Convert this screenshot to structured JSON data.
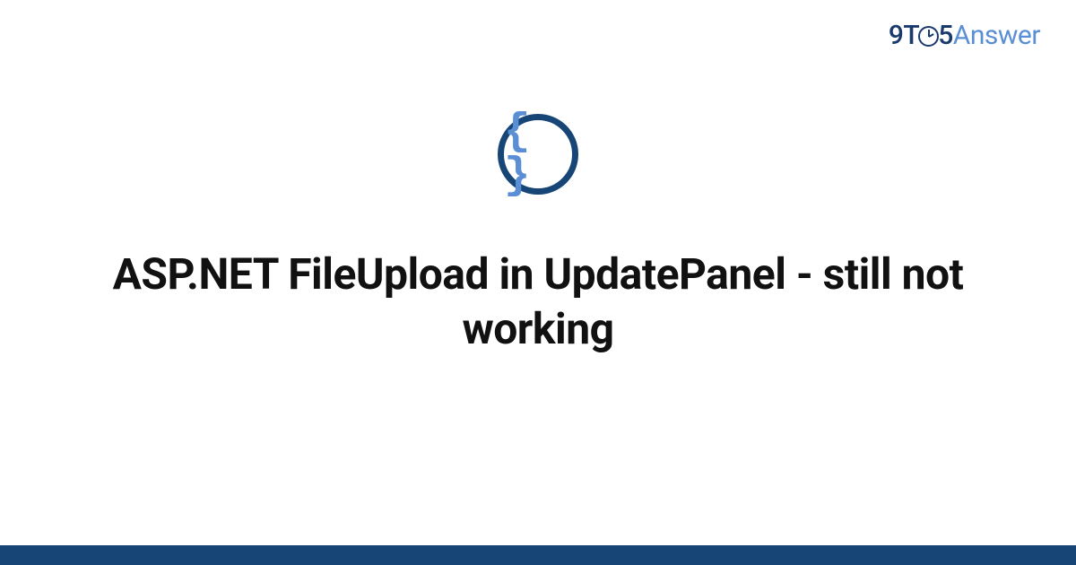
{
  "brand": {
    "nine": "9",
    "t": "T",
    "five": "5",
    "answer": "Answer"
  },
  "content": {
    "icon_name": "code-braces-icon",
    "braces_glyph": "{ }",
    "title": "ASP.NET FileUpload in UpdatePanel - still not working"
  },
  "colors": {
    "brand_dark": "#164576",
    "brand_light": "#5a8fd6",
    "text": "#111111",
    "background": "#ffffff"
  }
}
